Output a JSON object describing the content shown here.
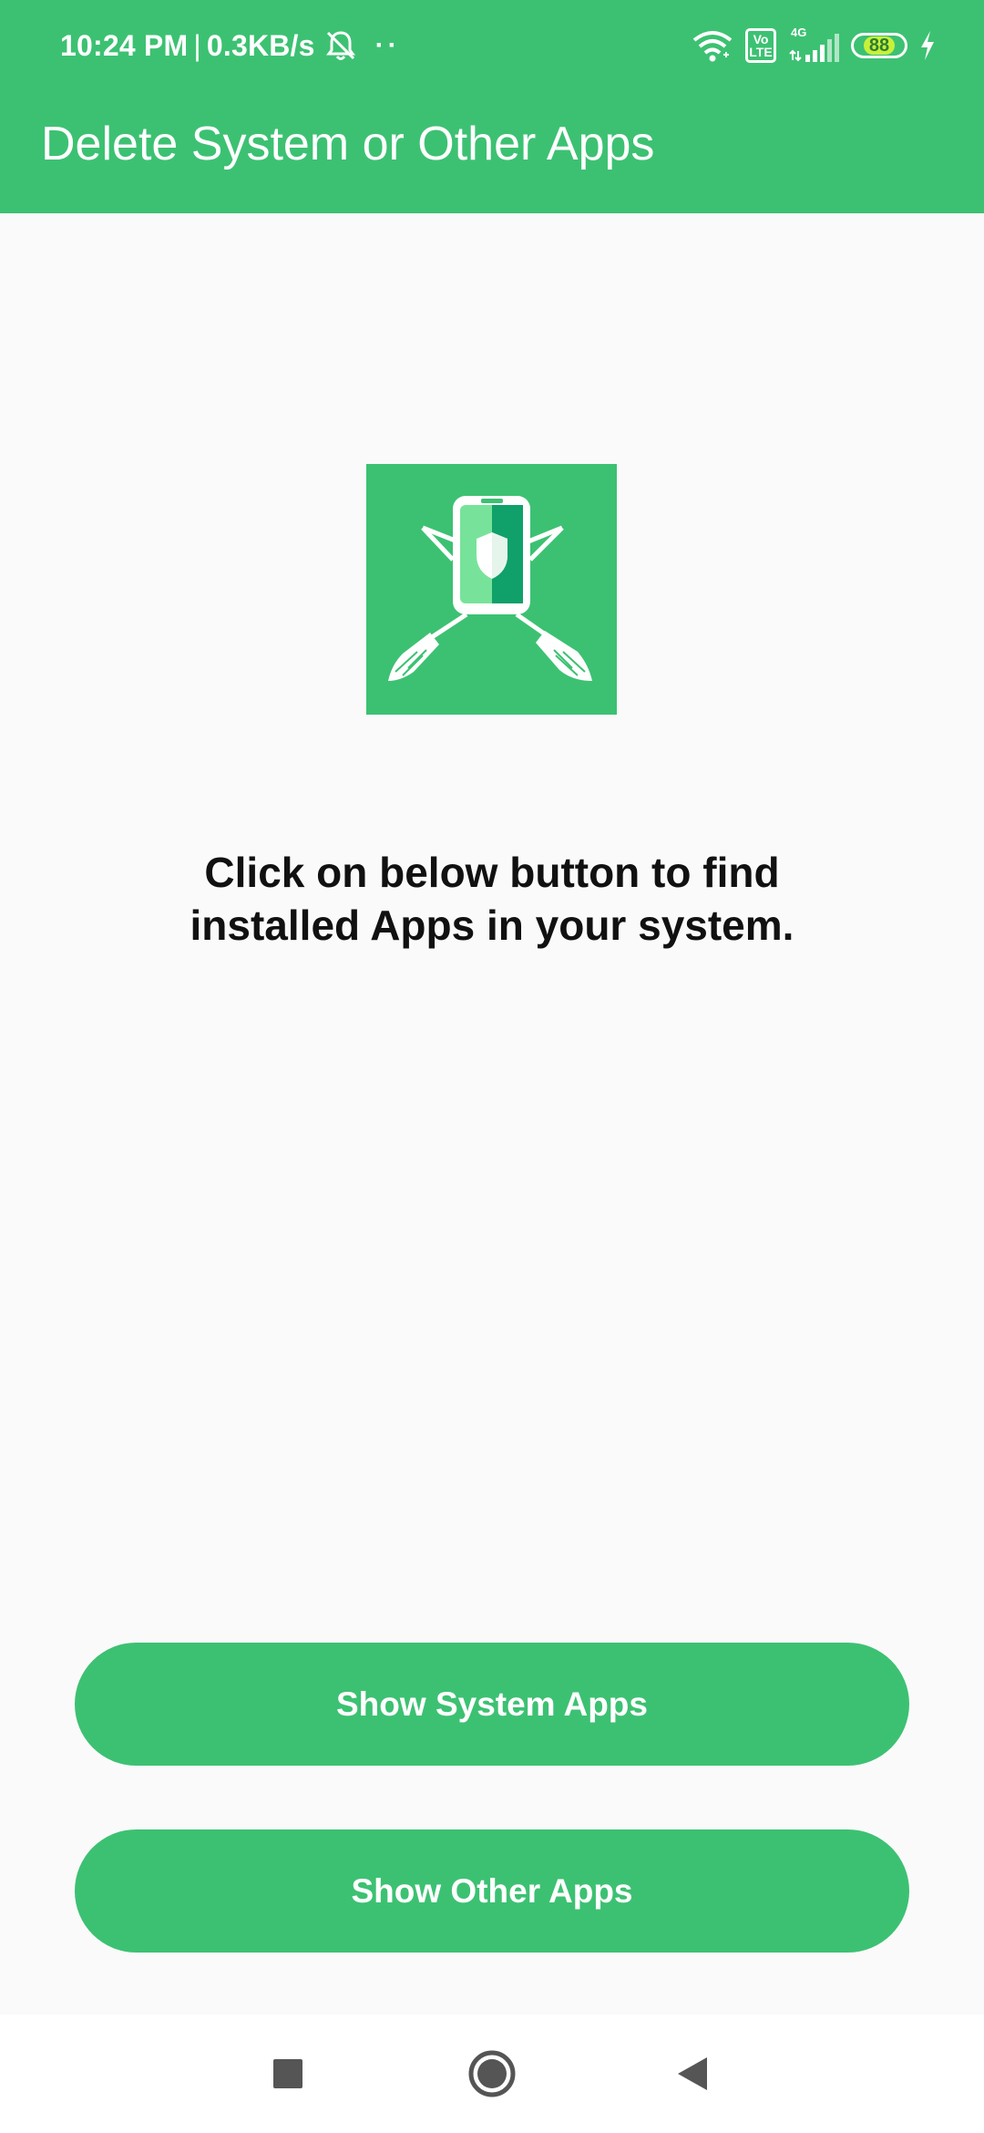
{
  "status_bar": {
    "time": "10:24 PM",
    "separator": "|",
    "network_speed": "0.3KB/s",
    "notification_dots": "··",
    "volte_label": "Vo LTE",
    "network_type": "4G",
    "battery_level": "88",
    "icons": [
      "mute-bell-icon",
      "wifi-icon",
      "volte-icon",
      "cellular-signal-icon",
      "battery-icon",
      "charging-icon"
    ]
  },
  "app_bar": {
    "title": "Delete System or Other Apps"
  },
  "main": {
    "hero_icon": "phone-shield-brooms-icon",
    "instruction": "Click on below button to find installed Apps in your system."
  },
  "actions": {
    "show_system_apps": "Show System Apps",
    "show_other_apps": "Show Other Apps"
  },
  "navigation": {
    "icons": [
      "recents-square-icon",
      "home-circle-icon",
      "back-triangle-icon"
    ]
  },
  "colors": {
    "primary": "#3cc172",
    "background": "#fafafa",
    "text": "#111111",
    "on_primary": "#ffffff"
  }
}
